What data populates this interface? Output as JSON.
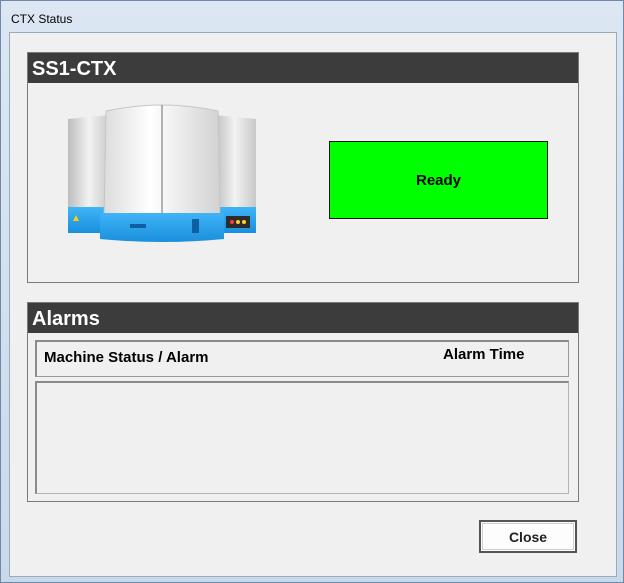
{
  "window": {
    "title": "CTX Status"
  },
  "machine_panel": {
    "header": "SS1-CTX",
    "image_icon": "ctx-machine-icon",
    "status_text": "Ready",
    "status_color": "#00ff00"
  },
  "alarms_panel": {
    "header": "Alarms",
    "columns": {
      "status": "Machine Status / Alarm",
      "time": "Alarm Time"
    },
    "rows": []
  },
  "buttons": {
    "close": "Close"
  },
  "colors": {
    "header_bg": "#3c3c3c",
    "machine_blue": "#1e9bea"
  }
}
